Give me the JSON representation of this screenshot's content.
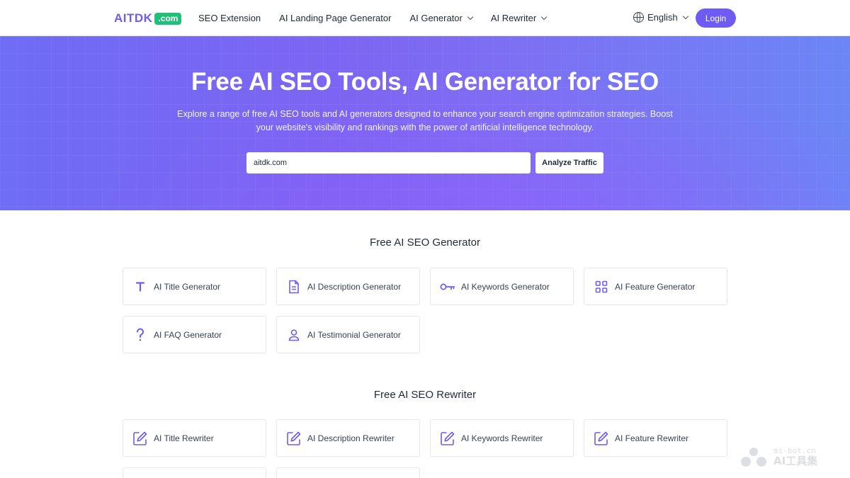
{
  "header": {
    "logo_text": "AITDK",
    "logo_badge": ".com",
    "nav": [
      {
        "label": "SEO Extension"
      },
      {
        "label": "AI Landing Page Generator"
      },
      {
        "label": "AI Generator"
      },
      {
        "label": "AI Rewriter"
      }
    ],
    "language": "English",
    "login_label": "Login"
  },
  "hero": {
    "title": "Free AI SEO Tools, AI Generator for SEO",
    "subtitle_line1": "Explore a range of free AI SEO tools and AI generators designed to enhance your search engine optimization strategies. Boost",
    "subtitle_line2": "your website's visibility and rankings with the power of artificial intelligence technology.",
    "search_value": "aitdk.com",
    "analyze_label": "Analyze Traffic"
  },
  "generator_section": {
    "title": "Free AI SEO Generator",
    "items": [
      {
        "label": "AI Title Generator",
        "icon": "title-t-icon"
      },
      {
        "label": "AI Description Generator",
        "icon": "document-icon"
      },
      {
        "label": "AI Keywords Generator",
        "icon": "key-icon"
      },
      {
        "label": "AI Feature Generator",
        "icon": "grid-icon"
      },
      {
        "label": "AI FAQ Generator",
        "icon": "question-icon"
      },
      {
        "label": "AI Testimonial Generator",
        "icon": "user-icon"
      }
    ]
  },
  "rewriter_section": {
    "title": "Free AI SEO Rewriter",
    "items": [
      {
        "label": "AI Title Rewriter",
        "icon": "edit-icon"
      },
      {
        "label": "AI Description Rewriter",
        "icon": "edit-icon"
      },
      {
        "label": "AI Keywords Rewriter",
        "icon": "edit-icon"
      },
      {
        "label": "AI Feature Rewriter",
        "icon": "edit-icon"
      }
    ]
  },
  "watermark": {
    "top": "ai-bot.cn",
    "bottom": "AI工具集"
  },
  "colors": {
    "accent": "#6d5bf2",
    "badge_green": "#20c07a"
  }
}
